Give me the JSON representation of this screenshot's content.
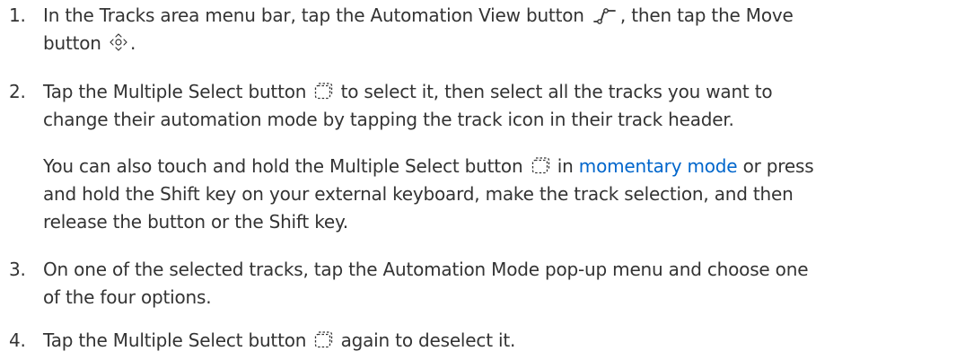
{
  "steps": [
    {
      "number": "1.",
      "parts": {
        "a": "In the Tracks area menu bar, tap the Automation View button",
        "b": ", then tap the Move",
        "c": "button",
        "d": "."
      },
      "icons": [
        "automation-view-icon",
        "move-icon"
      ]
    },
    {
      "number": "2.",
      "parts": {
        "a": "Tap the Multiple Select button",
        "b": "to select it, then select all the tracks you want to",
        "c": "change their automation mode by tapping the track icon in their track header."
      },
      "icons": [
        "multiple-select-icon"
      ]
    },
    {
      "parts": {
        "a": "You can also touch and hold the Multiple Select button",
        "b": "in",
        "link": "momentary mode",
        "c": "or press",
        "d": "and hold the Shift key on your external keyboard, make the track selection, and then",
        "e": "release the button or the Shift key."
      },
      "icons": [
        "multiple-select-icon"
      ],
      "link_color": "#0066cc"
    },
    {
      "number": "3.",
      "parts": {
        "a": "On one of the selected tracks, tap the Automation Mode pop-up menu and choose one",
        "b": "of the four options."
      }
    },
    {
      "number": "4.",
      "parts": {
        "a": "Tap the Multiple Select button",
        "b": "again to deselect it."
      },
      "icons": [
        "multiple-select-icon"
      ]
    }
  ],
  "text_color": "#333333"
}
